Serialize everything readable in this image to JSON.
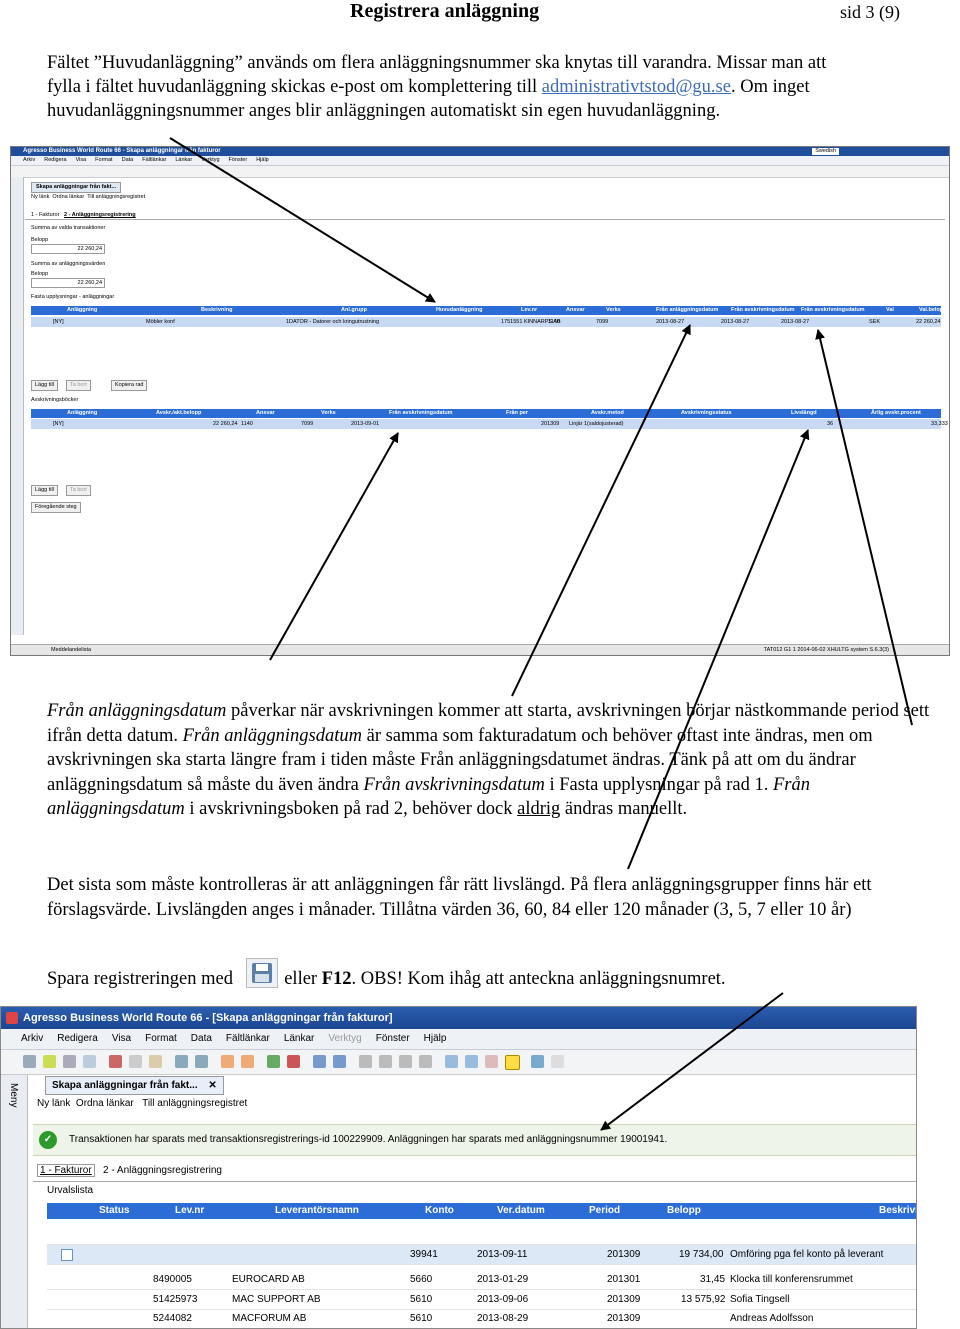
{
  "header": {
    "title": "Registrera anläggning",
    "page": "sid 3 (9)"
  },
  "para1": {
    "line1": "Fältet ”Huvudanläggning” används om flera anläggningsnummer ska knytas till varandra. Missar man att",
    "line2_pre": "fylla i fältet huvudanläggning skickas e-post om komplettering till ",
    "email": "administrativtstod@gu.se",
    "line2_post": ". Om inget",
    "line3": "huvudanläggningsnummer anges blir anläggningen automatiskt sin egen huvudanläggning."
  },
  "shot1": {
    "title": "Agresso Business World Route 66 - Skapa anläggningar från fakturor",
    "lang": "Swedish",
    "menu": [
      "Arkiv",
      "Redigera",
      "Visa",
      "Format",
      "Data",
      "Fältlänkar",
      "Länkar",
      "Verktyg",
      "Fönster",
      "Hjälp"
    ],
    "tab": "Skapa anläggningar från fakt...",
    "links": [
      "Ny länk",
      "Ordna länkar",
      "Till anläggningsregistret"
    ],
    "subtabs": [
      "1 - Fakturor",
      "2 - Anläggningsregistrering"
    ],
    "sum_box_label": "Summa av valda transaktioner",
    "belopp_label": "Belopp",
    "belopp_value": "22 260,24",
    "sum_reg_label": "Summa av anläggningsvärden",
    "belopp2_label": "Belopp",
    "belopp2_value": "22 260,24",
    "fasta_label": "Fasta upplysningar - anläggningar",
    "grid1_headers": [
      "Anläggning",
      "Beskrivning",
      "Anl.grupp",
      "Huvudanläggning",
      "Lev.nr",
      "Ansvar",
      "Verks",
      "Från anläggningsdatum",
      "Från avskrivningsdatum",
      "Från avskrivningsdatum",
      "Val",
      "Val.belopp"
    ],
    "grid1_row": [
      "[NY]",
      "Möbler konf",
      "1DATOR - Datorer och kringutrustning",
      "",
      "1751551 KINNARPS AB",
      "1140",
      "7099",
      "2013-08-27",
      "2013-08-27",
      "2013-08-27",
      "SEK",
      "22 260,24"
    ],
    "btn_add": "Lägg till",
    "btn_delete": "Ta bort",
    "btn_copy": "Kopiera rad",
    "avskr_label": "Avskrivningsböcker",
    "grid2_headers": [
      "Anläggning",
      "Avskr./akt.belopp",
      "Ansvar",
      "Verks",
      "Från avskrivningsdatum",
      "Från per",
      "Avskr.metod",
      "Avskrivningsstatus",
      "Livslängd",
      "Årlig avskr.procent"
    ],
    "grid2_row": [
      "[NY]",
      "22 260,24",
      "1140",
      "7099",
      "2013-09-01",
      "201309",
      "Linjär 1(saldojusterad)",
      "",
      "36",
      "33,333"
    ],
    "btn_prev": "Föregående steg",
    "status_tab": "Meddelandelista",
    "status_right": "TAT012   G1   1   2014-06-02   XHULTG   system   S.6.3(3)"
  },
  "para2": {
    "s1_it": "Från anläggningsdatum",
    "s1": " påverkar när avskrivningen kommer att starta, avskrivningen börjar nästkommande period sett ifrån detta datum. ",
    "s2_it": "Från anläggningsdatum",
    "s2": " är samma som fakturadatum och behöver oftast inte ändras, men om avskrivningen ska starta längre fram i tiden måste  Från anläggningsdatumet ändras. Tänk på att om du ändrar anläggningsdatum så måste du även ändra ",
    "s3_it": "Från avskrivningsdatum",
    "s3": " i Fasta upplysningar på rad 1. ",
    "s4_it": "Från anläggningsdatum",
    "s4": " i avskrivningsboken på rad 2, behöver dock ",
    "s4_u": "aldrig",
    "s4_end": " ändras manuellt."
  },
  "para3": {
    "text": "Det sista som måste kontrolleras är att anläggningen får rätt livslängd. På flera anläggningsgrupper finns här ett förslagsvärde. Livslängden anges i månader. Tillåtna värden 36, 60, 84  eller 120 månader (3, 5, 7 eller 10 år)"
  },
  "para4": {
    "pre": "Spara registreringen med",
    "mid": " eller ",
    "key": "F12",
    "post": ". OBS! Kom ihåg att anteckna anläggningsnumret."
  },
  "shot2": {
    "title": "Agresso Business World Route 66 - [Skapa anläggningar från fakturor]",
    "menu": [
      "Arkiv",
      "Redigera",
      "Visa",
      "Format",
      "Data",
      "Fältlänkar",
      "Länkar",
      "Verktyg",
      "Fönster",
      "Hjälp"
    ],
    "tab": "Skapa anläggningar från fakt...",
    "links": [
      "Ny länk",
      "Ordna länkar",
      "Till anläggningsregistret"
    ],
    "sidebar_label": "Meny",
    "message": "Transaktionen har sparats med transaktionsregistrerings-id 100229909. Anläggningen har sparats med anläggningsnummer 19001941.",
    "subtabs": [
      "1 - Fakturor",
      "2 - Anläggningsregistrering"
    ],
    "urval_label": "Urvalslista",
    "headers": [
      "Status",
      "Lev.nr",
      "Leverantörsnamn",
      "Konto",
      "Ver.datum",
      "Period",
      "Belopp",
      "Beskrivning"
    ],
    "rows": [
      [
        "",
        "",
        "",
        "39941",
        "2013-09-11",
        "201309",
        "19 734,00",
        "Omföring pga fel konto på leverant"
      ],
      [
        "",
        "8490005",
        "EUROCARD AB",
        "5660",
        "2013-01-29",
        "201301",
        "31,45",
        "Klocka till konferensrummet"
      ],
      [
        "",
        "51425973",
        "MAC SUPPORT AB",
        "5610",
        "2013-09-06",
        "201309",
        "13 575,92",
        "Sofia Tingsell"
      ],
      [
        "",
        "5244082",
        "MACFORUM AB",
        "5610",
        "2013-08-29",
        "201309",
        "",
        "Andreas Adolfsson"
      ]
    ]
  },
  "icons": {
    "save": "floppy-disk-icon"
  }
}
